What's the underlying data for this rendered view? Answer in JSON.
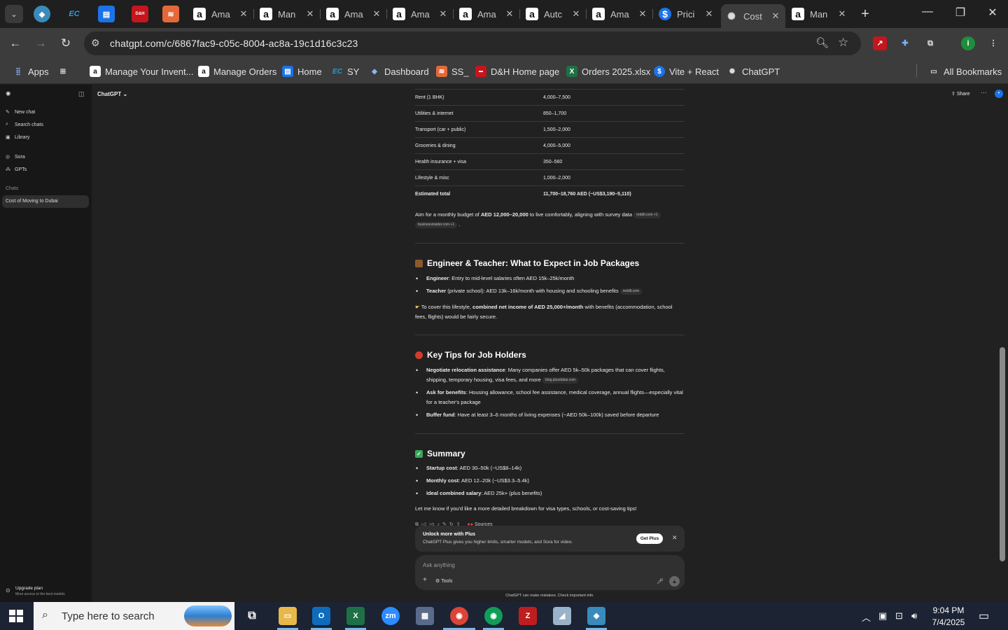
{
  "browser": {
    "tabs": [
      {
        "title": "Ama",
        "icon": "amazon-icon"
      },
      {
        "title": "Man",
        "icon": "amazon-icon"
      },
      {
        "title": "Ama",
        "icon": "amazon-icon"
      },
      {
        "title": "Ama",
        "icon": "amazon-icon"
      },
      {
        "title": "Ama",
        "icon": "amazon-icon"
      },
      {
        "title": "Autc",
        "icon": "amazon-icon"
      },
      {
        "title": "Ama",
        "icon": "amazon-icon"
      },
      {
        "title": "Prici",
        "icon": "dollar-icon"
      },
      {
        "title": "Cost",
        "icon": "chatgpt-icon",
        "active": true
      },
      {
        "title": "Man",
        "icon": "amazon-icon"
      }
    ],
    "pinned_labels": [
      "EC",
      "D&H"
    ],
    "url": "chatgpt.com/c/6867fac9-c05c-8004-ac8a-19c1d16c3c23",
    "bookmarks": [
      {
        "label": "Apps"
      },
      {
        "label": "Manage Your Invent..."
      },
      {
        "label": "Manage Orders"
      },
      {
        "label": "Home"
      },
      {
        "label": "SY"
      },
      {
        "label": "Dashboard"
      },
      {
        "label": "SS_"
      },
      {
        "label": "D&H Home page"
      },
      {
        "label": "Orders 2025.xlsx"
      },
      {
        "label": "Vite + React"
      },
      {
        "label": "ChatGPT"
      }
    ],
    "all_bookmarks": "All Bookmarks",
    "profile_initial": "i"
  },
  "sidebar": {
    "items": [
      "New chat",
      "Search chats",
      "Library",
      "Sora",
      "GPTs"
    ],
    "chats_header": "Chats",
    "active_chat": "Cost of Moving to Dubai",
    "upgrade_title": "Upgrade plan",
    "upgrade_sub": "More access to the best models"
  },
  "header": {
    "model": "ChatGPT",
    "share": "Share"
  },
  "cost_table": {
    "rows": [
      {
        "item": "Rent (1 BHK)",
        "cost": "4,000–7,500"
      },
      {
        "item": "Utilities & internet",
        "cost": "850–1,700"
      },
      {
        "item": "Transport (car + public)",
        "cost": "1,500–2,000"
      },
      {
        "item": "Groceries & dining",
        "cost": "4,000–5,000"
      },
      {
        "item": "Health insurance + visa",
        "cost": "350–560"
      },
      {
        "item": "Lifestyle & misc",
        "cost": "1,000–2,000"
      },
      {
        "item": "Estimated total",
        "cost": "11,700–18,760 AED (~US$3,190–5,110)"
      }
    ]
  },
  "budget_note": {
    "prefix": "Aim for a monthly budget of ",
    "bold": "AED 12,000–20,000",
    "suffix": " to live comfortably, aligning with survey data",
    "chip1": "reddit.com +1",
    "chip2": "businessinsider.com +1"
  },
  "section_jobs": {
    "title": "Engineer & Teacher: What to Expect in Job Packages",
    "b1_label": "Engineer",
    "b1_text": ": Entry to mid-level salaries often AED 15k–25k/month",
    "b2_label": "Teacher",
    "b2_text": " (private school): AED 13k–16k/month with housing and schooling benefits",
    "b2_chip": "reddit.com",
    "note_prefix": "To cover this lifestyle, ",
    "note_bold": "combined net income of AED 25,000+/month",
    "note_suffix": " with benefits (accommodation, school fees, flights) would be fairly secure."
  },
  "section_tips": {
    "title": "Key Tips for Job Holders",
    "b1_label": "Negotiate relocation assistance",
    "b1_text": ": Many companies offer AED 5k–50k packages that can cover flights, shipping, temporary housing, visa fees, and more",
    "b1_chip": "blog.plusdubai.com",
    "b2_label": "Ask for benefits",
    "b2_text": ": Housing allowance, school fee assistance, medical coverage, annual flights—especially vital for a teacher's package",
    "b3_label": "Buffer fund",
    "b3_text": ": Have at least 3–6 months of living expenses (~AED 50k–100k) saved before departure"
  },
  "section_summary": {
    "title": "Summary",
    "b1_label": "Startup cost",
    "b1_text": ": AED 30–50k (~US$8–14k)",
    "b2_label": "Monthly cost",
    "b2_text": ": AED 12–20k (~US$3.3–5.4k)",
    "b3_label": "Ideal combined salary",
    "b3_text": ": AED 25k+ (plus benefits)",
    "closing": "Let me know if you'd like a more detailed breakdown for visa types, schools, or cost-saving tips!",
    "sources": "Sources"
  },
  "plus_banner": {
    "title": "Unlock more with Plus",
    "subtitle": "ChatGPT Plus gives you higher limits, smarter models, and Sora for video.",
    "button": "Get Plus"
  },
  "composer": {
    "placeholder": "Ask anything",
    "tools": "Tools"
  },
  "disclaimer": "ChatGPT can make mistakes. Check important info.",
  "taskbar": {
    "search_placeholder": "Type here to search",
    "time": "9:04 PM",
    "date": "7/4/2025"
  }
}
